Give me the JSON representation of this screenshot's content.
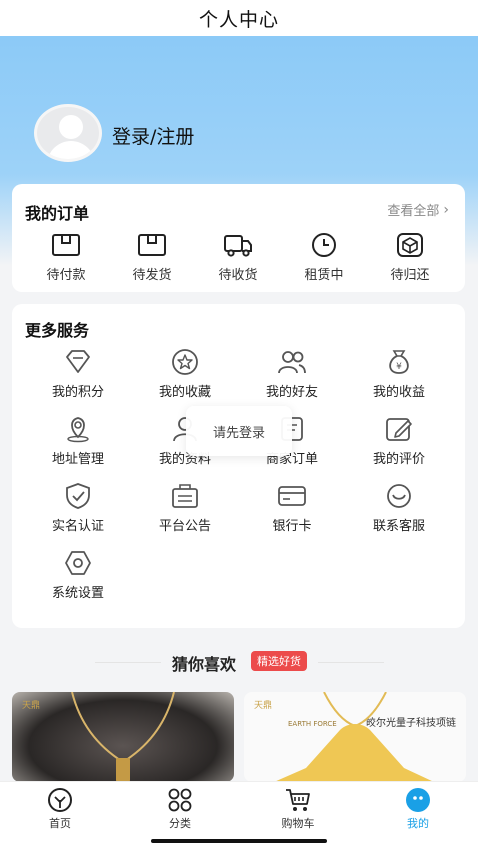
{
  "header": {
    "title": "个人中心"
  },
  "profile": {
    "login_label": "登录/注册"
  },
  "orders": {
    "title": "我的订单",
    "view_all": "查看全部",
    "items": [
      {
        "label": "待付款",
        "icon": "wallet-icon"
      },
      {
        "label": "待发货",
        "icon": "box-icon"
      },
      {
        "label": "待收货",
        "icon": "truck-icon"
      },
      {
        "label": "租赁中",
        "icon": "clock-icon"
      },
      {
        "label": "待归还",
        "icon": "package-return-icon"
      }
    ]
  },
  "services": {
    "title": "更多服务",
    "items": [
      {
        "label": "我的积分",
        "icon": "diamond-icon"
      },
      {
        "label": "我的收藏",
        "icon": "star-icon"
      },
      {
        "label": "我的好友",
        "icon": "friends-icon"
      },
      {
        "label": "我的收益",
        "icon": "money-bag-icon"
      },
      {
        "label": "地址管理",
        "icon": "location-icon"
      },
      {
        "label": "我的资料",
        "icon": "profile-icon"
      },
      {
        "label": "商家订单",
        "icon": "merchant-order-icon"
      },
      {
        "label": "我的评价",
        "icon": "edit-icon"
      },
      {
        "label": "实名认证",
        "icon": "shield-check-icon"
      },
      {
        "label": "平台公告",
        "icon": "notice-board-icon"
      },
      {
        "label": "银行卡",
        "icon": "bank-card-icon"
      },
      {
        "label": "联系客服",
        "icon": "smile-icon"
      },
      {
        "label": "系统设置",
        "icon": "settings-icon"
      }
    ]
  },
  "toast": {
    "text": "请先登录"
  },
  "recommend": {
    "title": "猜你喜欢",
    "badge": "精选好货",
    "products": [
      {
        "brand": "天鼎"
      },
      {
        "brand": "天鼎",
        "sub_brand": "EARTH FORCE",
        "caption": "皎尔光量子科技项链"
      }
    ]
  },
  "tabbar": {
    "items": [
      {
        "label": "首页",
        "icon": "home-icon"
      },
      {
        "label": "分类",
        "icon": "grid-icon"
      },
      {
        "label": "购物车",
        "icon": "cart-icon"
      },
      {
        "label": "我的",
        "icon": "me-icon",
        "active": true
      }
    ],
    "active_color": "#1aa0e6"
  },
  "colors": {
    "hero": "#8ccaf7",
    "accent": "#1aa0e6",
    "badge": "#ec4b4b"
  }
}
